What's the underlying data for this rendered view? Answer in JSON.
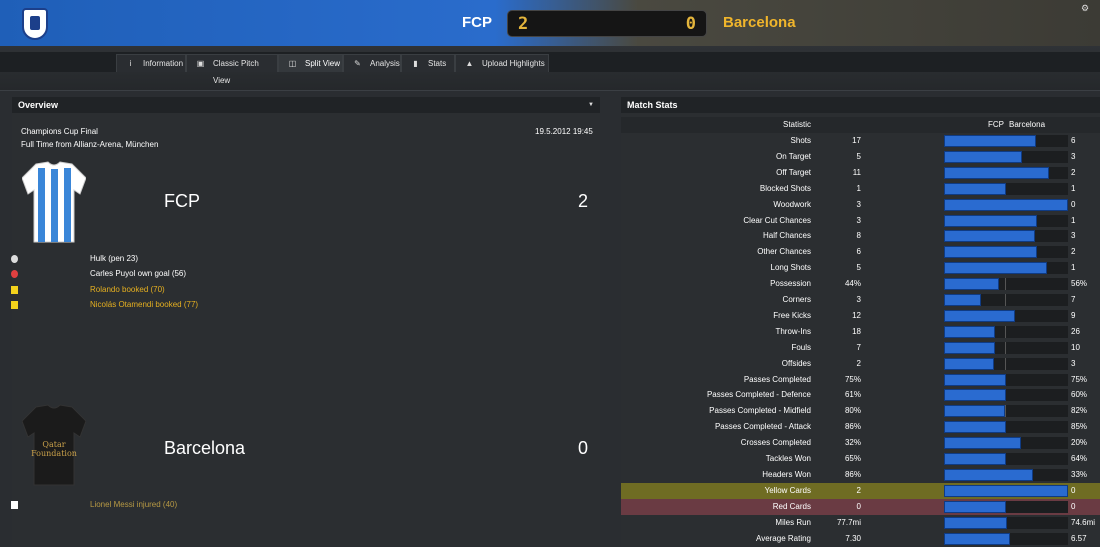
{
  "header": {
    "home_team": "FCP",
    "away_team": "Barcelona",
    "home_score": "2",
    "away_score": "0",
    "colors": {
      "home": "#2a6ccc",
      "away": "#f0b52b"
    }
  },
  "tabs": [
    {
      "label": "Information",
      "icon": "info-icon"
    },
    {
      "label": "Classic Pitch View",
      "icon": "pitch-icon"
    },
    {
      "label": "Split View",
      "icon": "split-view-icon",
      "active": true
    },
    {
      "label": "Analysis",
      "icon": "analysis-icon"
    },
    {
      "label": "Stats",
      "icon": "stats-icon"
    },
    {
      "label": "Upload Highlights",
      "icon": "upload-icon"
    }
  ],
  "overview": {
    "title": "Overview",
    "competition": "Champions Cup Final",
    "venue": "Full Time from Allianz-Arena, München",
    "datetime": "19.5.2012 19:45",
    "home": {
      "name": "FCP",
      "score": "2",
      "events": [
        {
          "type": "goal-icon",
          "text": "Hulk (pen 23)",
          "color": "#ffffff"
        },
        {
          "type": "own-goal-icon",
          "text": "Carles Puyol own goal (56)",
          "color": "#ffffff"
        },
        {
          "type": "yellow-card-icon",
          "text": "Rolando booked (70)",
          "color": "#e6b020"
        },
        {
          "type": "yellow-card-icon",
          "text": "Nicolás Otamendi booked (77)",
          "color": "#e6b020"
        }
      ]
    },
    "away": {
      "name": "Barcelona",
      "score": "0",
      "shirt_text": [
        "Qatar",
        "Foundation"
      ],
      "events": [
        {
          "type": "injury-icon",
          "text": "Lionel Messi injured (40)",
          "color": "#b89a44"
        }
      ]
    }
  },
  "match_stats": {
    "title": "Match Stats",
    "col_statistic": "Statistic",
    "col_home": "FCP",
    "col_away": "Barcelona",
    "rows": [
      {
        "label": "Shots",
        "home": "17",
        "away": "6",
        "share": 0.74
      },
      {
        "label": "On Target",
        "home": "5",
        "away": "3",
        "share": 0.63
      },
      {
        "label": "Off Target",
        "home": "11",
        "away": "2",
        "share": 0.85
      },
      {
        "label": "Blocked Shots",
        "home": "1",
        "away": "1",
        "share": 0.5
      },
      {
        "label": "Woodwork",
        "home": "3",
        "away": "0",
        "share": 1.0
      },
      {
        "label": "Clear Cut Chances",
        "home": "3",
        "away": "1",
        "share": 0.75
      },
      {
        "label": "Half Chances",
        "home": "8",
        "away": "3",
        "share": 0.73
      },
      {
        "label": "Other Chances",
        "home": "6",
        "away": "2",
        "share": 0.75
      },
      {
        "label": "Long Shots",
        "home": "5",
        "away": "1",
        "share": 0.83
      },
      {
        "label": "Possession",
        "home": "44%",
        "away": "56%",
        "share": 0.44
      },
      {
        "label": "Corners",
        "home": "3",
        "away": "7",
        "share": 0.3
      },
      {
        "label": "Free Kicks",
        "home": "12",
        "away": "9",
        "share": 0.57
      },
      {
        "label": "Throw-Ins",
        "home": "18",
        "away": "26",
        "share": 0.41
      },
      {
        "label": "Fouls",
        "home": "7",
        "away": "10",
        "share": 0.41
      },
      {
        "label": "Offsides",
        "home": "2",
        "away": "3",
        "share": 0.4
      },
      {
        "label": "Passes Completed",
        "home": "75%",
        "away": "75%",
        "share": 0.5
      },
      {
        "label": "Passes Completed - Defence",
        "home": "61%",
        "away": "60%",
        "share": 0.5
      },
      {
        "label": "Passes Completed - Midfield",
        "home": "80%",
        "away": "82%",
        "share": 0.49
      },
      {
        "label": "Passes Completed - Attack",
        "home": "86%",
        "away": "85%",
        "share": 0.5
      },
      {
        "label": "Crosses Completed",
        "home": "32%",
        "away": "20%",
        "share": 0.62
      },
      {
        "label": "Tackles Won",
        "home": "65%",
        "away": "64%",
        "share": 0.5
      },
      {
        "label": "Headers Won",
        "home": "86%",
        "away": "33%",
        "share": 0.72
      },
      {
        "label": "Yellow Cards",
        "home": "2",
        "away": "0",
        "share": 1.0,
        "highlight": "yellow"
      },
      {
        "label": "Red Cards",
        "home": "0",
        "away": "0",
        "share": 0.5,
        "highlight": "red"
      },
      {
        "label": "Miles Run",
        "home": "77.7mi",
        "away": "74.6mi",
        "share": 0.51
      },
      {
        "label": "Average Rating",
        "home": "7.30",
        "away": "6.57",
        "share": 0.53
      }
    ]
  }
}
